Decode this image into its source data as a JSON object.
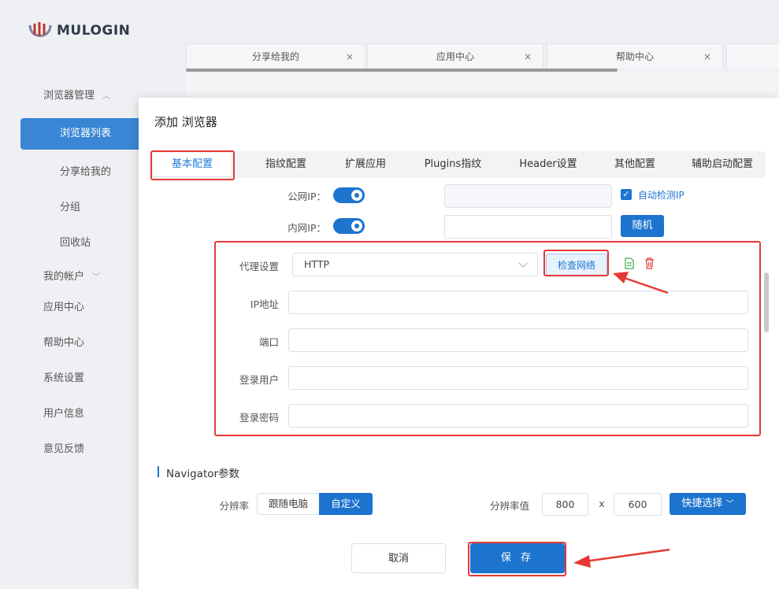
{
  "app": {
    "logo_text": "MULOGIN"
  },
  "sidebar": {
    "browser_mgmt": "浏览器管理",
    "items": [
      "浏览器列表",
      "分享给我的",
      "分组",
      "回收站"
    ],
    "my_account": "我的帐户",
    "app_center": "应用中心",
    "help_center": "帮助中心",
    "system_settings": "系统设置",
    "user_info": "用户信息",
    "feedback": "意见反馈"
  },
  "bg_tabs": [
    {
      "label": "分享给我的"
    },
    {
      "label": "应用中心"
    },
    {
      "label": "帮助中心"
    }
  ],
  "dialog": {
    "title": "添加 浏览器",
    "tabs": [
      "基本配置",
      "指纹配置",
      "扩展应用",
      "Plugins指纹",
      "Header设置",
      "其他配置",
      "辅助启动配置"
    ],
    "public_ip_label": "公网IP：",
    "private_ip_label": "内网IP：",
    "auto_detect_label": "自动检测IP",
    "random_button": "随机",
    "proxy_label": "代理设置",
    "proxy_value": "HTTP",
    "check_network_button": "检查网络",
    "ip_label": "IP地址",
    "port_label": "端口",
    "user_label": "登录用户",
    "password_label": "登录密码",
    "navigator_title": "Navigator参数",
    "resolution_label": "分辨率",
    "follow_pc": "跟随电脑",
    "custom": "自定义",
    "resolution_value_label": "分辨率值",
    "width": "800",
    "x_sep": "x",
    "height": "600",
    "quick_select": "快捷选择",
    "cancel": "取消",
    "save": "保 存"
  },
  "colors": {
    "primary": "#1d74cf",
    "highlight": "#e53935"
  }
}
